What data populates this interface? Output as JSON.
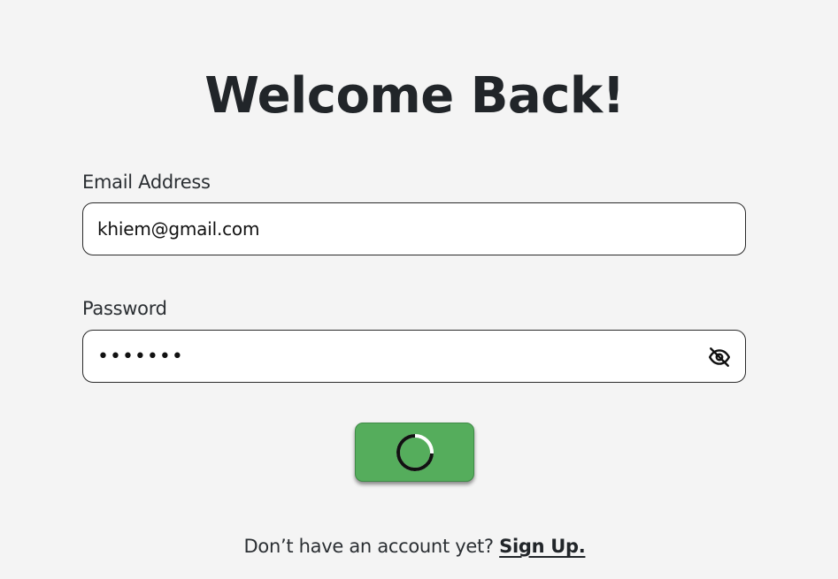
{
  "heading": "Welcome Back!",
  "email": {
    "label": "Email Address",
    "value": "khiem@gmail.com"
  },
  "password": {
    "label": "Password",
    "value": "•••••••",
    "toggle_icon": "eye-slash-icon"
  },
  "submit": {
    "state": "loading",
    "icon": "loading-spinner-icon",
    "color": "#55ad5c"
  },
  "footer": {
    "prompt": "Don’t have an account yet?",
    "link": "Sign Up."
  }
}
